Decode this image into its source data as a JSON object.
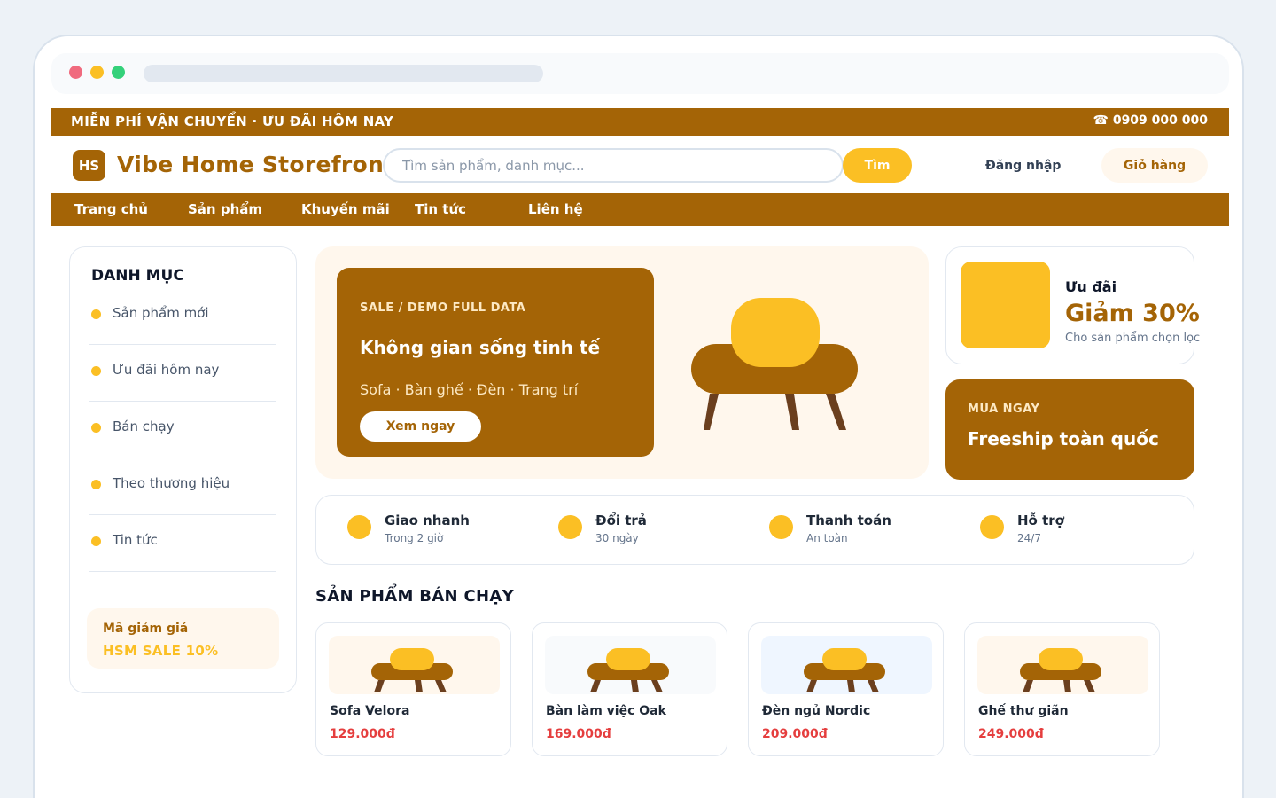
{
  "colors": {
    "brand": "#a46406",
    "accent": "#fbbf24",
    "price": "#e53e3e",
    "cream": "#fff7ed"
  },
  "topbar": {
    "promo": "MIỄN PHÍ VẬN CHUYỂN · ƯU ĐÃI HÔM NAY",
    "phone": "☎ 0909 000 000"
  },
  "header": {
    "logo_initials": "HS",
    "brand": "Vibe Home Storefront",
    "search_placeholder": "Tìm sản phẩm, danh mục...",
    "search_button": "Tìm",
    "login": "Đăng nhập",
    "cart": "Giỏ hàng"
  },
  "nav": {
    "items": [
      "Trang chủ",
      "Sản phẩm",
      "Khuyến mãi",
      "Tin tức",
      "Liên hệ"
    ]
  },
  "sidebar": {
    "title": "DANH MỤC",
    "items": [
      "Sản phẩm mới",
      "Ưu đãi hôm nay",
      "Bán chạy",
      "Theo thương hiệu",
      "Tin tức"
    ],
    "coupon_label": "Mã giảm giá",
    "coupon_code": "HSM SALE 10%"
  },
  "hero": {
    "kicker": "SALE / DEMO FULL DATA",
    "title": "Không gian sống tinh tế",
    "subtitle": "Sofa · Bàn ghế · Đèn · Trang trí",
    "cta": "Xem ngay"
  },
  "promo": {
    "label": "Ưu đãi",
    "value": "Giảm 30%",
    "note": "Cho sản phẩm chọn lọc"
  },
  "buy": {
    "kicker": "MUA NGAY",
    "title": "Freeship toàn quốc"
  },
  "benefits": [
    {
      "title": "Giao nhanh",
      "sub": "Trong 2 giờ"
    },
    {
      "title": "Đổi trả",
      "sub": "30 ngày"
    },
    {
      "title": "Thanh toán",
      "sub": "An toàn"
    },
    {
      "title": "Hỗ trợ",
      "sub": "24/7"
    }
  ],
  "bestsellers": {
    "title": "SẢN PHẨM BÁN CHẠY",
    "products": [
      {
        "name": "Sofa Velora",
        "price": "129.000đ"
      },
      {
        "name": "Bàn làm việc Oak",
        "price": "169.000đ"
      },
      {
        "name": "Đèn ngủ Nordic",
        "price": "209.000đ"
      },
      {
        "name": "Ghế thư giãn",
        "price": "249.000đ"
      }
    ]
  }
}
